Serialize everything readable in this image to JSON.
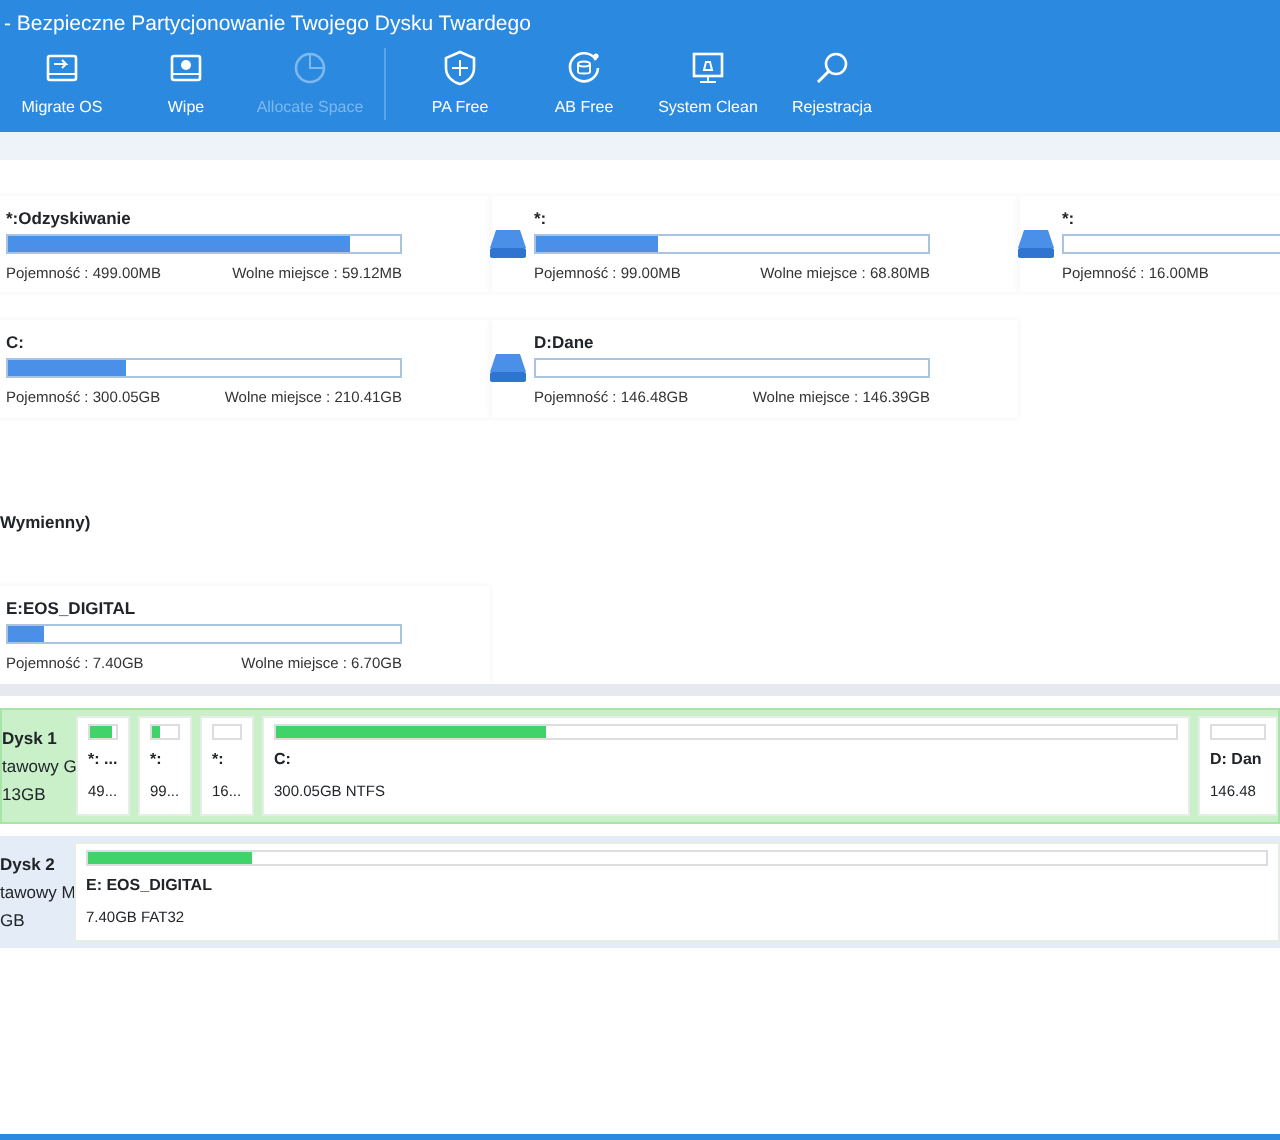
{
  "title_bar": {
    "title": "- Bezpieczne Partycjonowanie Twojego Dysku Twardego"
  },
  "toolbar": {
    "groups": [
      [
        {
          "label": "Migrate OS",
          "kind": "migrate",
          "disabled": false
        },
        {
          "label": "Wipe",
          "kind": "wipe",
          "disabled": false
        },
        {
          "label": "Allocate Space",
          "kind": "allocate",
          "disabled": true
        }
      ],
      [
        {
          "label": "PA Free",
          "kind": "shield",
          "disabled": false
        },
        {
          "label": "AB Free",
          "kind": "backup",
          "disabled": false
        },
        {
          "label": "System Clean",
          "kind": "clean",
          "disabled": false
        },
        {
          "label": "Rejestracja",
          "kind": "search",
          "disabled": false
        }
      ]
    ]
  },
  "volume_groups": [
    {
      "volumes": [
        {
          "name": "*:Odzyskiwanie",
          "level": 0.87,
          "capacity": "Pojemność : 499.00MB",
          "free": "Wolne miejsce : 59.12MB"
        },
        {
          "name": "*:",
          "level": 0.31,
          "capacity": "Pojemność : 99.00MB",
          "free": "Wolne miejsce : 68.80MB"
        },
        {
          "name": "*:",
          "level": 0,
          "capacity": "Pojemność : 16.00MB"
        },
        {
          "name": "C:",
          "level": 0.3,
          "capacity": "Pojemność : 300.05GB",
          "free": "Wolne miejsce : 210.41GB"
        },
        {
          "name": "D:Dane",
          "level": 0,
          "capacity": "Pojemność : 146.48GB",
          "free": "Wolne miejsce : 146.39GB"
        }
      ]
    },
    {
      "heading": "Wymienny)",
      "volumes": [
        {
          "name": "E:EOS_DIGITAL",
          "level": 0.09,
          "capacity": "Pojemność : 7.40GB",
          "free": "Wolne miejsce : 6.70GB"
        }
      ]
    }
  ],
  "disks": [
    {
      "name": "Dysk 1",
      "type": "tawowy G",
      "size": "13GB",
      "selected": true,
      "partitions": [
        {
          "kind": "small",
          "name": "*: ...",
          "size": "49...",
          "level": 0.87
        },
        {
          "kind": "small",
          "name": "*:",
          "size": "99...",
          "level": 0.31
        },
        {
          "kind": "small",
          "name": "*:",
          "size": "16...",
          "level": 0
        },
        {
          "kind": "large",
          "name": "C:",
          "size": "300.05GB NTFS",
          "level": 0.3
        },
        {
          "kind": "cut",
          "name": "D: Dan",
          "size": "146.48",
          "level": 0
        }
      ]
    },
    {
      "name": "Dysk 2",
      "type": "tawowy M",
      "size": "GB",
      "selected": false,
      "partitions": [
        {
          "kind": "large",
          "name": "E: EOS_DIGITAL",
          "size": "7.40GB FAT32",
          "level": 0.14
        }
      ]
    }
  ]
}
